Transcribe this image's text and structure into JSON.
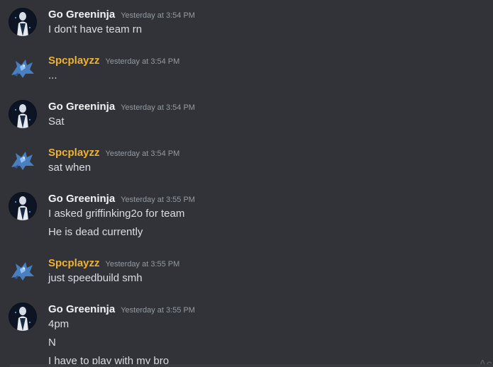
{
  "colors": {
    "background": "#313338",
    "text": "#dbdee1",
    "timestamp": "#949ba4"
  },
  "users": {
    "greeninja": {
      "name": "Go Greeninja",
      "color": "#f2f3f5",
      "avatar_icon": "ninja-avatar-icon"
    },
    "spcplayzz": {
      "name": "Spcplayzz",
      "color": "#f0b232",
      "avatar_icon": "dragon-avatar-icon"
    }
  },
  "messages": [
    {
      "user": "Go Greeninja",
      "timestamp": "Yesterday at 3:54 PM",
      "lines": [
        "I don't have team rn"
      ]
    },
    {
      "user": "Spcplayzz",
      "timestamp": "Yesterday at 3:54 PM",
      "lines": [
        "..."
      ]
    },
    {
      "user": "Go Greeninja",
      "timestamp": "Yesterday at 3:54 PM",
      "lines": [
        "Sat"
      ]
    },
    {
      "user": "Spcplayzz",
      "timestamp": "Yesterday at 3:54 PM",
      "lines": [
        "sat when"
      ]
    },
    {
      "user": "Go Greeninja",
      "timestamp": "Yesterday at 3:55 PM",
      "lines": [
        "I asked griffinking2o for team",
        "He is dead currently"
      ]
    },
    {
      "user": "Spcplayzz",
      "timestamp": "Yesterday at 3:55 PM",
      "lines": [
        "just speedbuild smh"
      ]
    },
    {
      "user": "Go Greeninja",
      "timestamp": "Yesterday at 3:55 PM",
      "lines": [
        "4pm",
        "N",
        "I have to play with my bro"
      ]
    }
  ],
  "scroll_hint": "Ac"
}
